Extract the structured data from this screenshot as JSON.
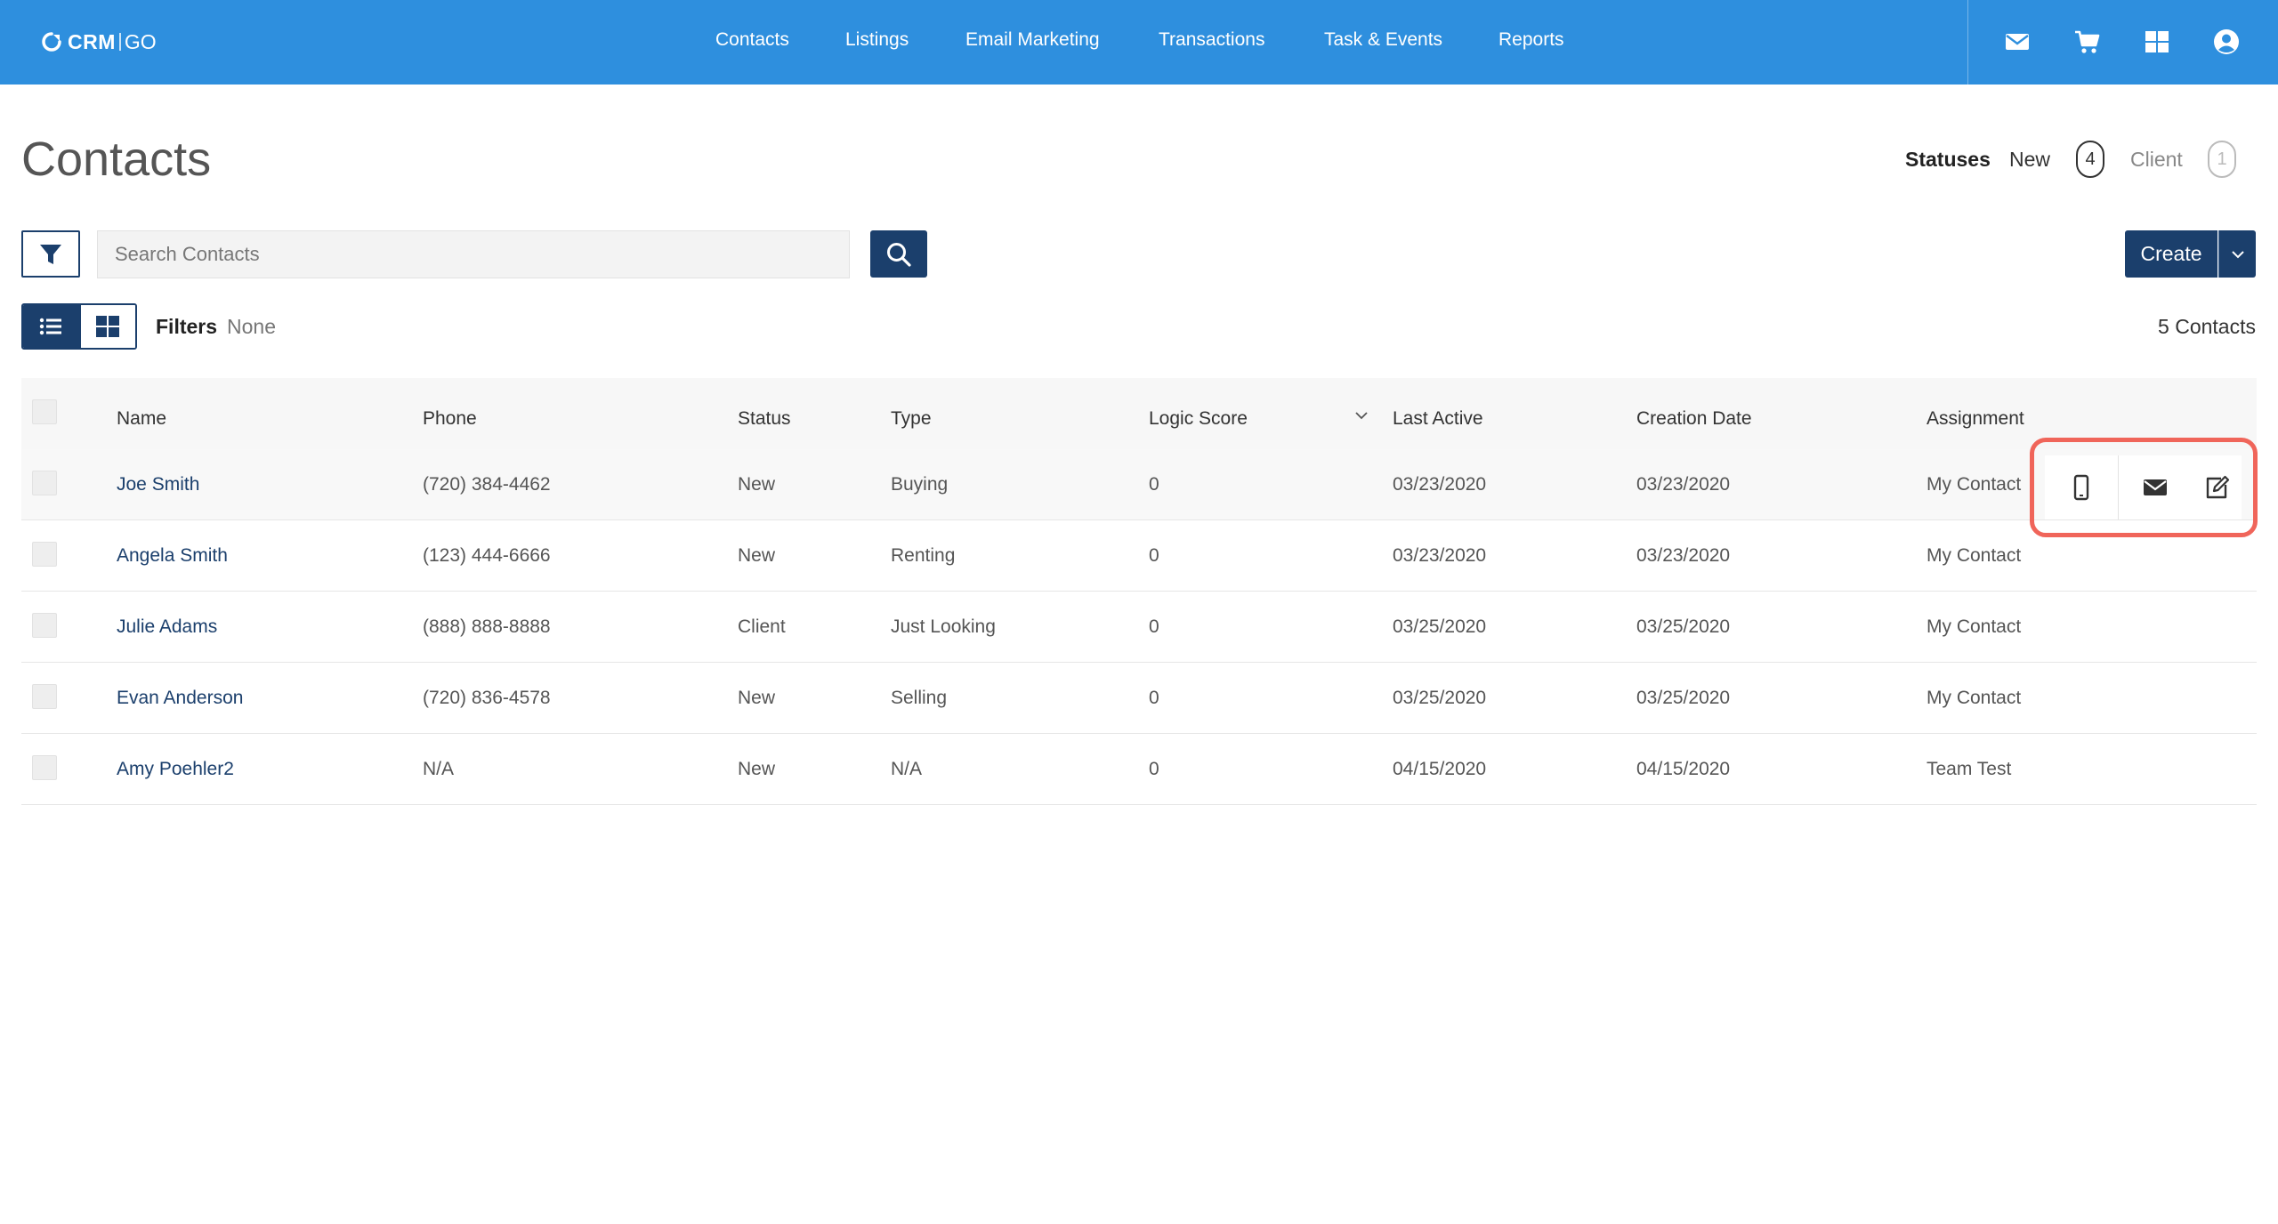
{
  "app": {
    "logo_primary": "CRM",
    "logo_secondary": "GO"
  },
  "nav": {
    "items": [
      {
        "label": "Contacts"
      },
      {
        "label": "Listings"
      },
      {
        "label": "Email Marketing"
      },
      {
        "label": "Transactions"
      },
      {
        "label": "Task & Events"
      },
      {
        "label": "Reports"
      }
    ],
    "icons": [
      "envelope-icon",
      "cart-icon",
      "apps-grid-icon",
      "user-account-icon"
    ]
  },
  "page": {
    "title": "Contacts",
    "statuses_label": "Statuses",
    "status_new_label": "New",
    "status_new_count": "4",
    "status_client_label": "Client",
    "status_client_count": "1"
  },
  "search": {
    "placeholder": "Search Contacts",
    "value": ""
  },
  "toolbar": {
    "create_label": "Create",
    "filters_label": "Filters",
    "filters_value": "None",
    "contact_count": "5 Contacts"
  },
  "table": {
    "columns": {
      "name": "Name",
      "phone": "Phone",
      "status": "Status",
      "type": "Type",
      "logic_score": "Logic Score",
      "last_active": "Last Active",
      "creation_date": "Creation Date",
      "assignment": "Assignment"
    },
    "rows": [
      {
        "name": "Joe Smith",
        "phone": "(720) 384-4462",
        "status": "New",
        "type": "Buying",
        "logic_score": "0",
        "last_active": "03/23/2020",
        "creation_date": "03/23/2020",
        "assignment": "My Contact"
      },
      {
        "name": "Angela Smith",
        "phone": "(123) 444-6666",
        "status": "New",
        "type": "Renting",
        "logic_score": "0",
        "last_active": "03/23/2020",
        "creation_date": "03/23/2020",
        "assignment": "My Contact"
      },
      {
        "name": "Julie Adams",
        "phone": "(888) 888-8888",
        "status": "Client",
        "type": "Just Looking",
        "logic_score": "0",
        "last_active": "03/25/2020",
        "creation_date": "03/25/2020",
        "assignment": "My Contact"
      },
      {
        "name": "Evan Anderson",
        "phone": "(720) 836-4578",
        "status": "New",
        "type": "Selling",
        "logic_score": "0",
        "last_active": "03/25/2020",
        "creation_date": "03/25/2020",
        "assignment": "My Contact"
      },
      {
        "name": "Amy Poehler2",
        "phone": "N/A",
        "status": "New",
        "type": "N/A",
        "logic_score": "0",
        "last_active": "04/15/2020",
        "creation_date": "04/15/2020",
        "assignment": "Team Test"
      }
    ],
    "row_actions": [
      "mobile-phone-icon",
      "envelope-icon",
      "edit-icon"
    ]
  },
  "colors": {
    "topbar": "#2e8fde",
    "primary_dark": "#1b3f6c",
    "link": "#1b3f6c",
    "highlight": "#f0655a"
  }
}
